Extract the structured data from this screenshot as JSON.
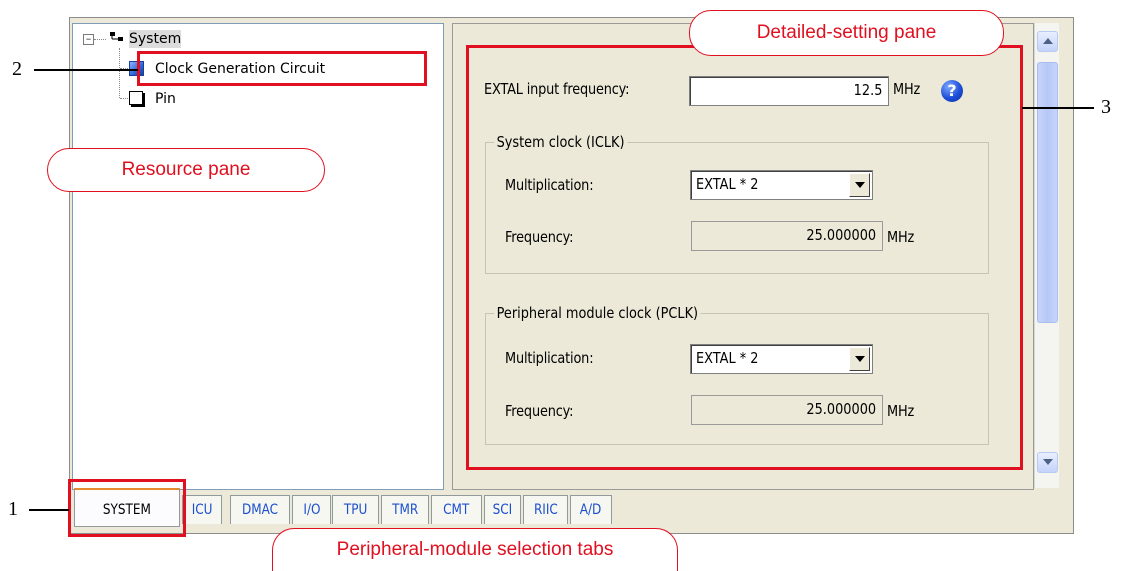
{
  "tree": {
    "root_label": "System",
    "items": [
      {
        "label": "Clock Generation Circuit",
        "icon": "blue-node-icon"
      },
      {
        "label": "Pin",
        "icon": "white-node-icon"
      }
    ]
  },
  "detail": {
    "extal_label": "EXTAL input frequency:",
    "extal_value": "12.5",
    "extal_unit": "MHz",
    "system_clock": {
      "title": "System clock (ICLK)",
      "mult_label": "Multiplication:",
      "mult_value": "EXTAL * 2",
      "freq_label": "Frequency:",
      "freq_value": "25.000000",
      "freq_unit": "MHz"
    },
    "peripheral_clock": {
      "title": "Peripheral module clock (PCLK)",
      "mult_label": "Multiplication:",
      "mult_value": "EXTAL * 2",
      "freq_label": "Frequency:",
      "freq_value": "25.000000",
      "freq_unit": "MHz"
    }
  },
  "tabs": [
    "SYSTEM",
    "ICU",
    "DMAC",
    "I/O",
    "TPU",
    "TMR",
    "CMT",
    "SCI",
    "RIIC",
    "A/D"
  ],
  "active_tab": "SYSTEM",
  "annotations": {
    "resource_pane": "Resource pane",
    "detailed_setting_pane": "Detailed-setting pane",
    "tabs_callout": "Peripheral-module selection tabs",
    "numbers": [
      "1",
      "2",
      "3"
    ]
  },
  "colors": {
    "highlight_red": "#e01020",
    "tab_text_blue": "#1c4fd0",
    "active_tab_accent": "#e68b2c"
  }
}
